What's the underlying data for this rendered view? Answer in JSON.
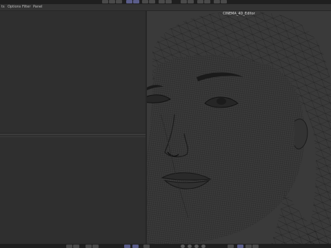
{
  "menu": {
    "items": [
      {
        "label": "ts"
      },
      {
        "label": "Options"
      },
      {
        "label": "Filter"
      },
      {
        "label": "Panel"
      }
    ]
  },
  "viewport": {
    "title": "CINEMA_4D_Editor"
  },
  "colors": {
    "accent": "#5a5d8a",
    "wire": "#1c1c1c",
    "mesh_background": "#3a3a3a"
  },
  "icons": [
    "toolbar-icon",
    "viewport-control-icon",
    "render-icon"
  ]
}
